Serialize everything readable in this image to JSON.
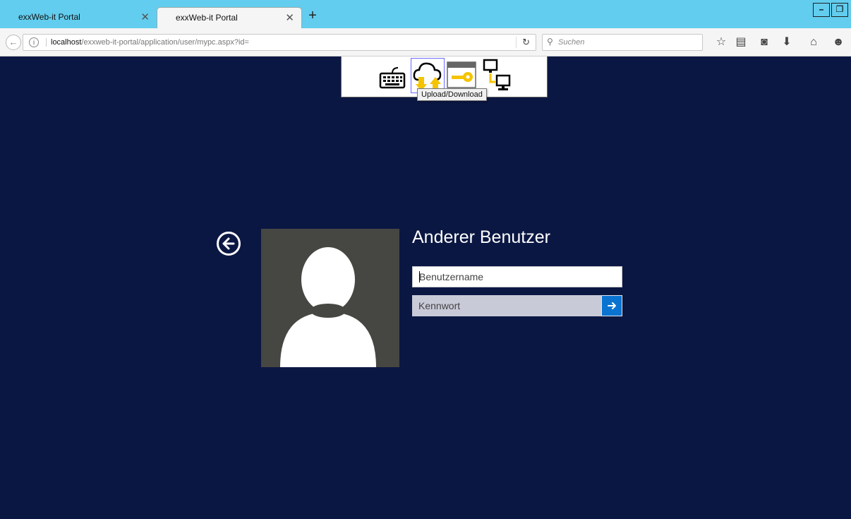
{
  "browser": {
    "tabs": [
      {
        "title": "exxWeb-it Portal",
        "active": false
      },
      {
        "title": "exxWeb-it Portal",
        "active": true
      }
    ],
    "url": {
      "host": "localhost",
      "path": "/exxweb-it-portal/application/user/mypc.aspx?id="
    },
    "search_placeholder": "Suchen"
  },
  "toolbar": {
    "tools": [
      "keyboard-icon",
      "upload-download-icon",
      "key-window-icon",
      "monitors-icon"
    ],
    "tooltip": "Upload/Download"
  },
  "login": {
    "title": "Anderer Benutzer",
    "username_placeholder": "Benutzername",
    "password_placeholder": "Kennwort"
  },
  "colors": {
    "background": "#0b1743",
    "tabstrip": "#62cdee",
    "accent": "#0a73d0",
    "avatar_bg": "#464642",
    "icon_yellow": "#f5c400"
  }
}
